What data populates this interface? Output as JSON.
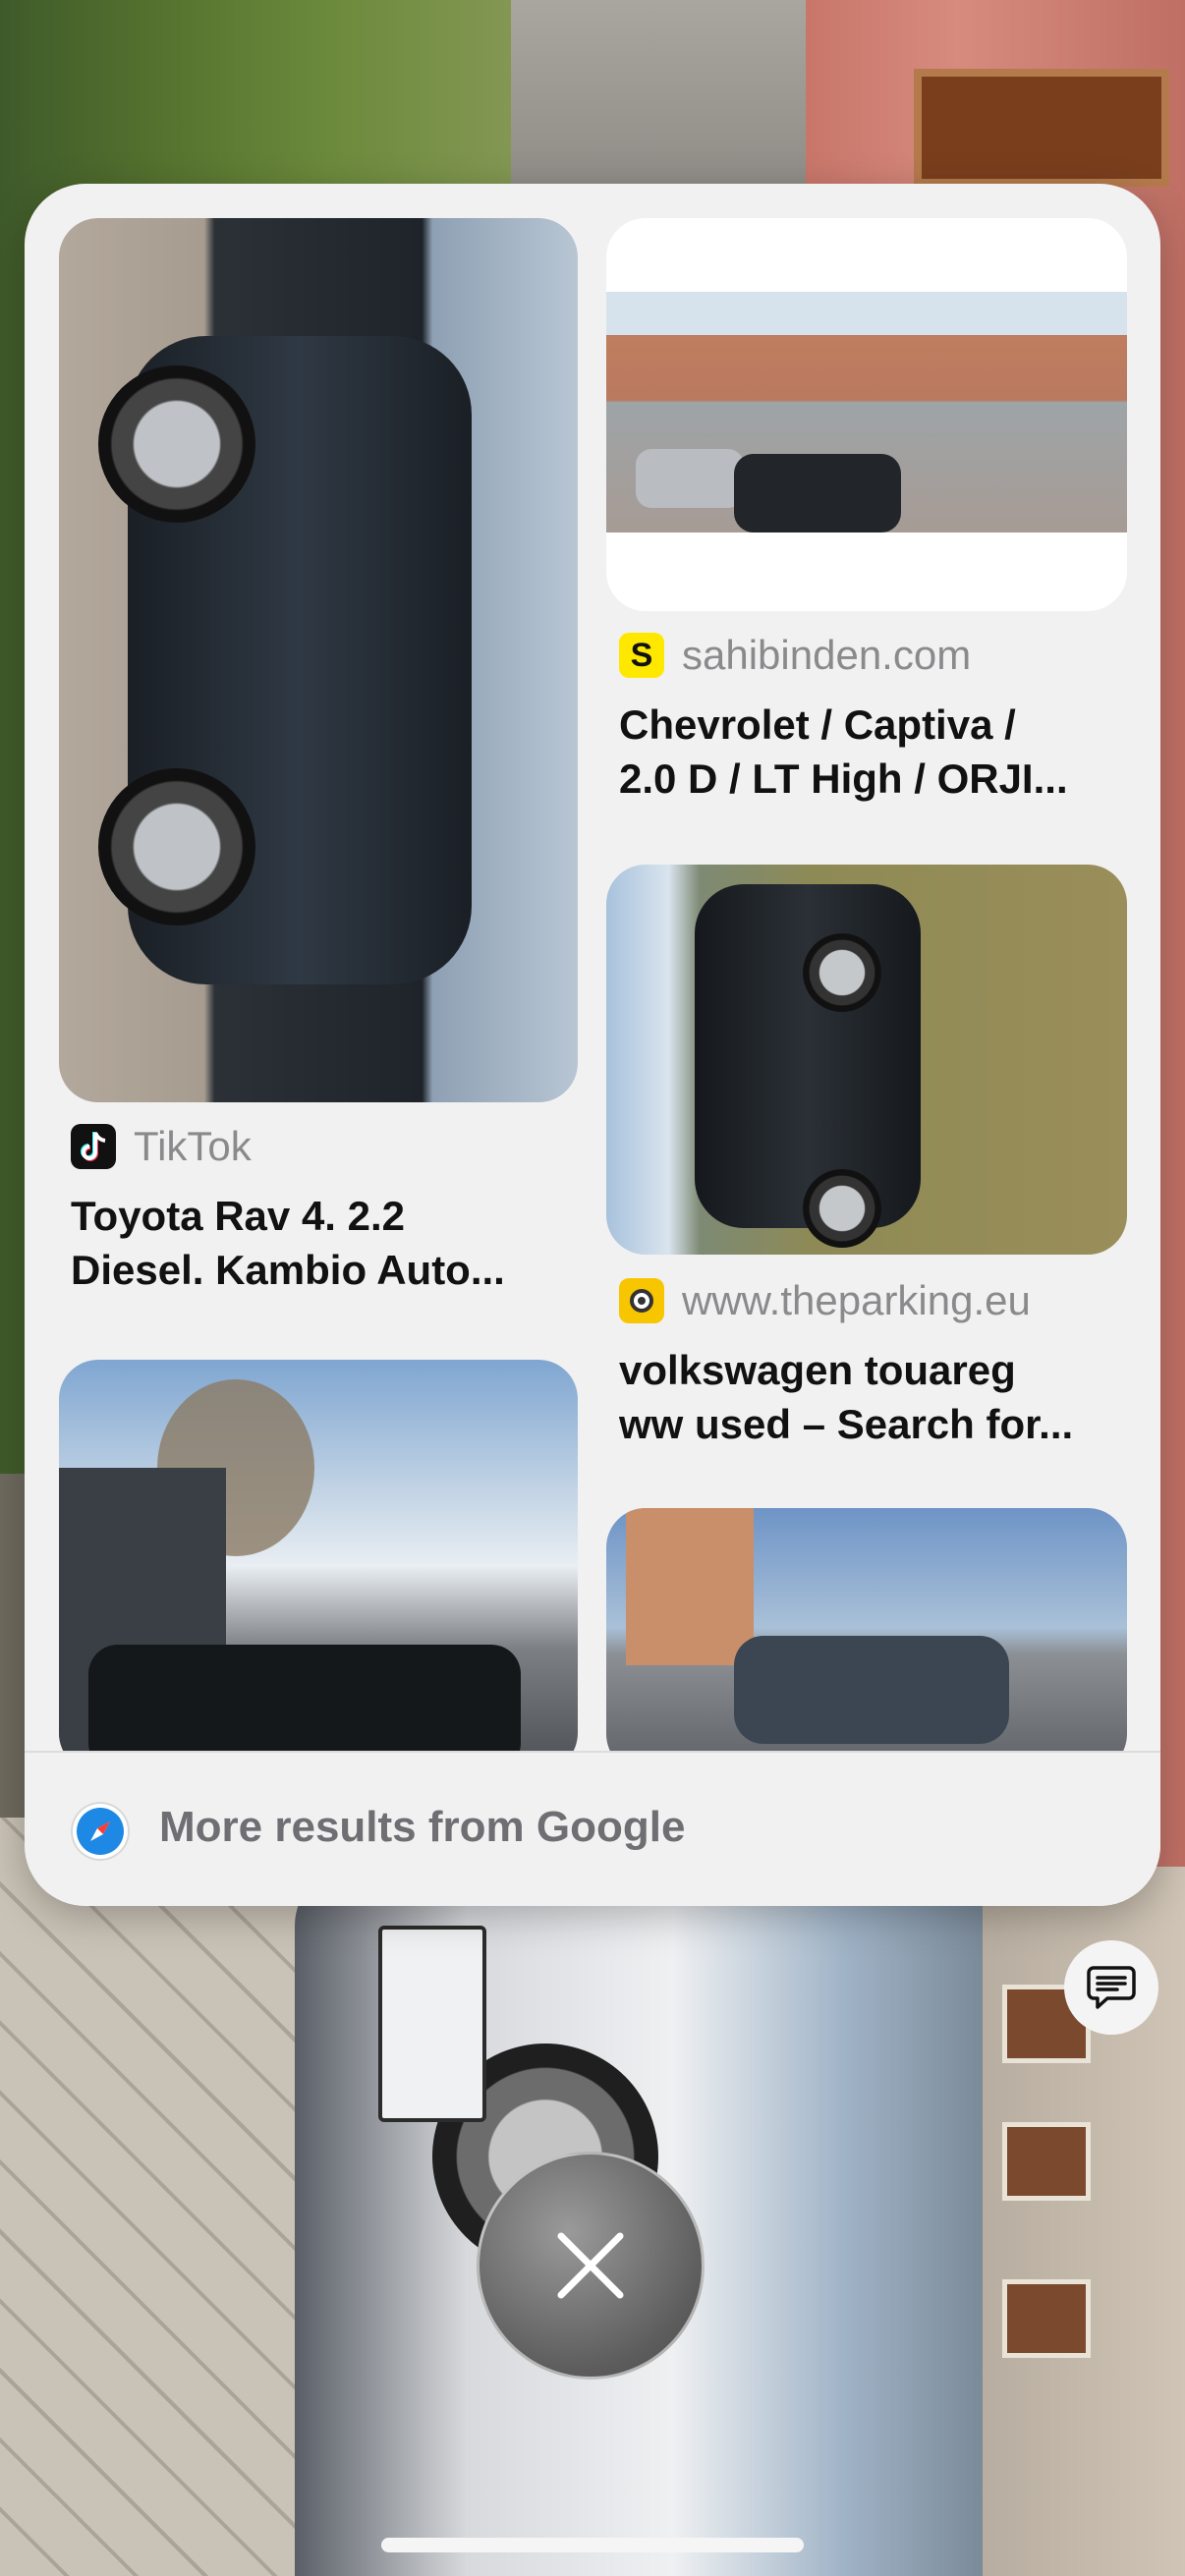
{
  "results": [
    {
      "source_name": "TikTok",
      "source_icon": "tiktok-icon",
      "title_line1": "Toyota Rav 4. 2.2",
      "title_line2": "Diesel. Kambio Auto..."
    },
    {
      "source_name": "sahibinden.com",
      "source_icon": "sahibinden-icon",
      "source_icon_letter": "S",
      "title_line1": "Chevrolet / Captiva /",
      "title_line2": "2.0 D / LT High / ORJI..."
    },
    {
      "source_name": "www.theparking.eu",
      "source_icon": "theparking-icon",
      "title_line1": "volkswagen touareg",
      "title_line2": "ww used – Search for..."
    }
  ],
  "more_results": {
    "label": "More results from Google",
    "icon": "safari-compass-icon"
  },
  "controls": {
    "chat_icon": "chat-bubble-icon",
    "close_icon": "close-icon"
  },
  "colors": {
    "sheet_background": "#f2f1f1",
    "sahibinden_yellow": "#ffe800",
    "theparking_yellow": "#f7c600",
    "safari_blue": "#1e88e5"
  }
}
